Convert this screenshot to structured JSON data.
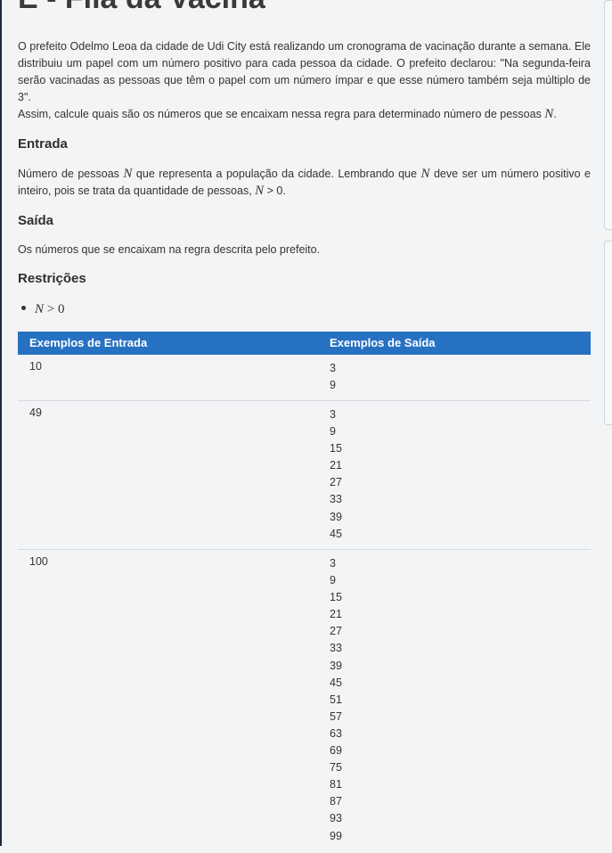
{
  "problem": {
    "title": "E - Fila da Vacina",
    "statement_1": "O prefeito Odelmo Leoa da cidade de Udi City está realizando um cronograma de vacinação durante a semana. Ele distribuiu um papel com um número positivo para cada pessoa da cidade. O prefeito declarou: \"Na segunda-feira serão vacinadas as pessoas que têm o papel com um número ímpar e que esse número também seja múltiplo de 3\".",
    "statement_2_prefix": "Assim, calcule quais são os números que se encaixam nessa regra para determinado número de pessoas ",
    "statement_2_var": "N",
    "statement_2_suffix": "."
  },
  "input_section": {
    "heading": "Entrada",
    "text_a": "Número de pessoas ",
    "var_a": "N",
    "text_b": " que representa a população da cidade. Lembrando que ",
    "var_b": "N",
    "text_c": " deve ser um número positivo e inteiro, pois se trata da quantidade de pessoas, ",
    "var_c": "N",
    "text_d": " > 0."
  },
  "output_section": {
    "heading": "Saída",
    "text": "Os números que se encaixam na regra descrita pelo prefeito."
  },
  "restrictions": {
    "heading": "Restrições",
    "items": [
      {
        "var": "N",
        "rest": " > 0"
      }
    ]
  },
  "examples": {
    "header_input": "Exemplos de Entrada",
    "header_output": "Exemplos de Saída",
    "rows": [
      {
        "input": "10",
        "output": "3\n9"
      },
      {
        "input": "49",
        "output": "3\n9\n15\n21\n27\n33\n39\n45"
      },
      {
        "input": "100",
        "output": "3\n9\n15\n21\n27\n33\n39\n45\n51\n57\n63\n69\n75\n81\n87\n93\n99"
      }
    ]
  }
}
